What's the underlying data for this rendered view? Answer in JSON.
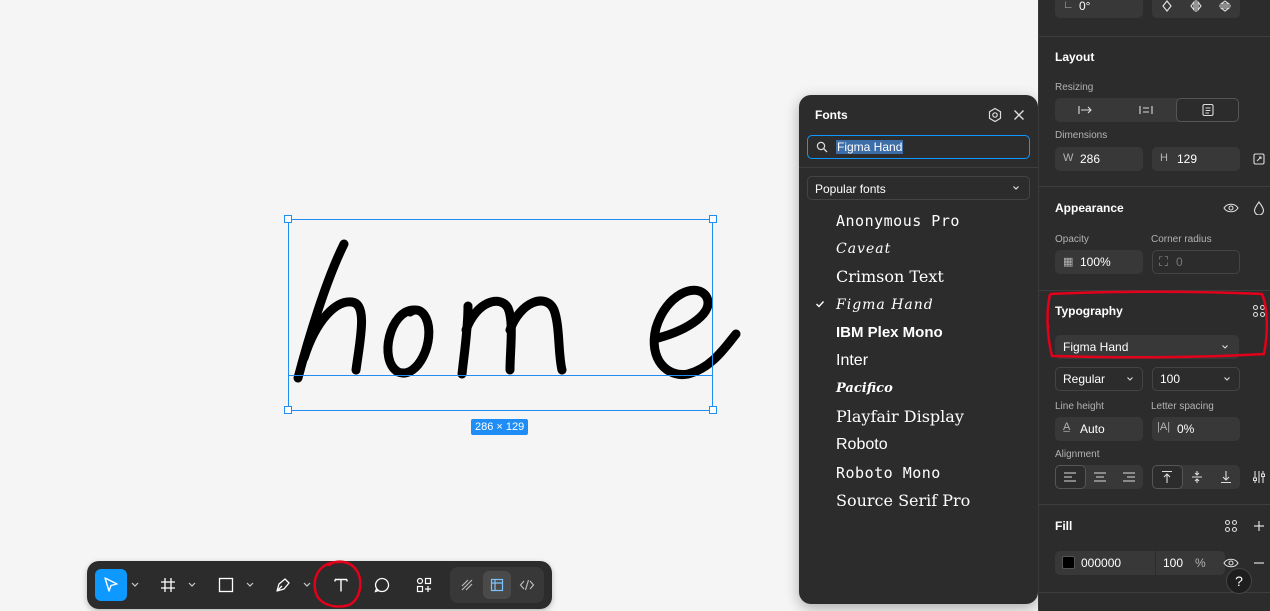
{
  "canvas": {
    "text_layer": "home",
    "size_badge": "286 × 129"
  },
  "toolbar": {
    "tools": [
      {
        "name": "move",
        "icon": "cursor-icon",
        "active": true
      },
      {
        "name": "frame",
        "icon": "frame-icon"
      },
      {
        "name": "shape",
        "icon": "rectangle-icon"
      },
      {
        "name": "pen",
        "icon": "pen-icon"
      },
      {
        "name": "text",
        "icon": "text-icon"
      },
      {
        "name": "comment",
        "icon": "comment-icon"
      },
      {
        "name": "actions",
        "icon": "actions-icon"
      }
    ],
    "modes": [
      {
        "name": "draw",
        "icon": "draw-icon"
      },
      {
        "name": "design",
        "icon": "design-icon",
        "selected": true
      },
      {
        "name": "dev",
        "icon": "code-icon"
      }
    ],
    "annotation_color": "#e3001b"
  },
  "fonts_panel": {
    "title": "Fonts",
    "search_value": "Figma Hand",
    "category": "Popular fonts",
    "fonts": [
      {
        "name": "Anonymous Pro",
        "style": "mono",
        "checked": false
      },
      {
        "name": "Caveat",
        "style": "hand",
        "checked": false
      },
      {
        "name": "Crimson Text",
        "style": "serif",
        "checked": false
      },
      {
        "name": "Figma Hand",
        "style": "hand",
        "checked": true
      },
      {
        "name": "IBM Plex Mono",
        "style": "bold",
        "checked": false
      },
      {
        "name": "Inter",
        "style": "sans",
        "checked": false
      },
      {
        "name": "Pacifico",
        "style": "pacifico",
        "checked": false
      },
      {
        "name": "Playfair Display",
        "style": "serif",
        "checked": false
      },
      {
        "name": "Roboto",
        "style": "sans",
        "checked": false
      },
      {
        "name": "Roboto Mono",
        "style": "mono",
        "checked": false
      },
      {
        "name": "Source Serif Pro",
        "style": "serif",
        "checked": false
      }
    ]
  },
  "props": {
    "rotation": "0°",
    "layout": {
      "title": "Layout",
      "resizing_label": "Resizing",
      "dimensions_label": "Dimensions",
      "w_label": "W",
      "w_value": "286",
      "h_label": "H",
      "h_value": "129"
    },
    "appearance": {
      "title": "Appearance",
      "opacity_label": "Opacity",
      "opacity_value": "100%",
      "corner_label": "Corner radius",
      "corner_value": "0"
    },
    "typography": {
      "title": "Typography",
      "font_family": "Figma Hand",
      "weight": "Regular",
      "size": "100",
      "line_height_label": "Line height",
      "line_height_value": "Auto",
      "letter_spacing_label": "Letter spacing",
      "letter_spacing_value": "0%",
      "alignment_label": "Alignment"
    },
    "fill": {
      "title": "Fill",
      "hex": "000000",
      "opacity": "100",
      "pct": "%",
      "swatch_color": "#000000"
    },
    "help": "?"
  },
  "colors": {
    "accent": "#0d99ff",
    "selection": "#1f8df5",
    "panel": "#2c2c2c"
  }
}
